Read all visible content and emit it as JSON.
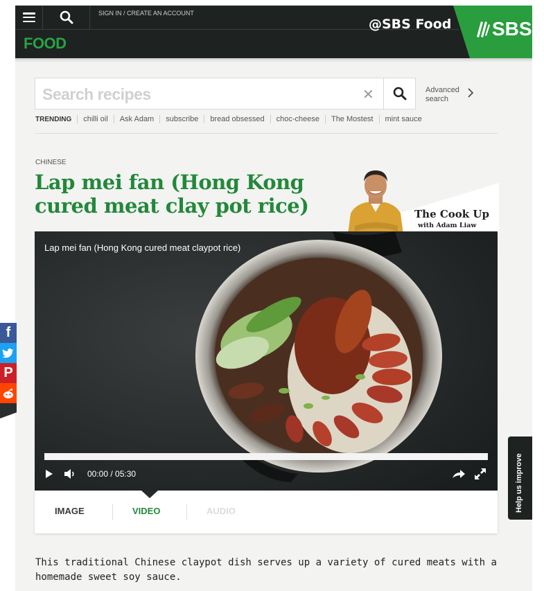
{
  "header": {
    "signin_label": "SIGN IN / CREATE AN ACCOUNT",
    "section_label": "FOOD",
    "handle": "@SBS Food",
    "logo_text": "SBS",
    "brand_color": "#2a9d3f",
    "bg_color": "#1e2221"
  },
  "search": {
    "placeholder": "Search recipes",
    "clear_icon": "close-icon",
    "advanced_line1": "Advanced",
    "advanced_line2": "search"
  },
  "trending": {
    "label": "TRENDING",
    "items": [
      "chilli oil",
      "Ask Adam",
      "subscribe",
      "bread obsessed",
      "choc-cheese",
      "The Mostest",
      "mint sauce"
    ]
  },
  "recipe": {
    "category": "CHINESE",
    "title": "Lap mei fan (Hong Kong cured meat clay pot rice)",
    "title_color": "#23883a",
    "description": "This traditional Chinese claypot dish serves up a variety of cured meats with a homemade sweet soy sauce."
  },
  "promo": {
    "title": "The Cook Up",
    "subtitle": "with Adam Liaw"
  },
  "video": {
    "title": "Lap mei fan (Hong Kong cured meat claypot rice)",
    "time": "00:00 / 05:30",
    "progress": 0
  },
  "media_tabs": [
    {
      "label": "IMAGE",
      "state": "inactive",
      "color": "#333333"
    },
    {
      "label": "VIDEO",
      "state": "active",
      "color": "#23883a"
    },
    {
      "label": "AUDIO",
      "state": "disabled",
      "color": "#dcdcdc"
    }
  ],
  "social": [
    {
      "icon": "facebook-icon",
      "color": "#3b5998"
    },
    {
      "icon": "twitter-icon",
      "color": "#1da1f2"
    },
    {
      "icon": "pinterest-icon",
      "color": "#cb2027"
    },
    {
      "icon": "reddit-icon",
      "color": "#ff4500"
    }
  ],
  "help": {
    "label": "Help us improve"
  }
}
